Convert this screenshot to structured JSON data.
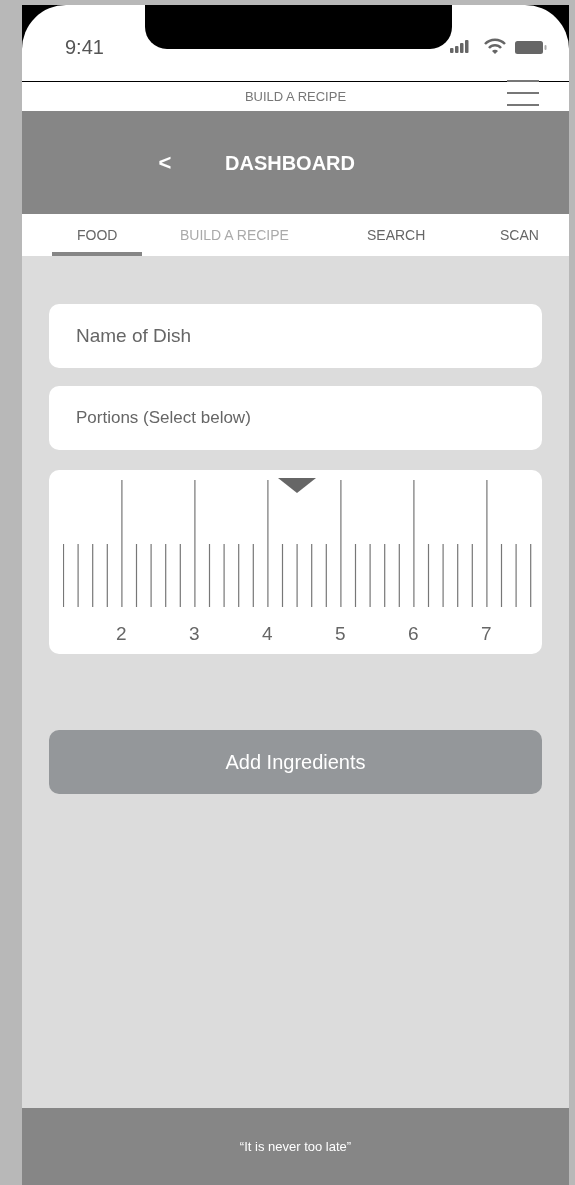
{
  "status_bar": {
    "time": "9:41"
  },
  "app_bar": {
    "title": "BUILD A RECIPE"
  },
  "header": {
    "back": "<",
    "title": "DASHBOARD"
  },
  "tabs": [
    {
      "label": "FOOD",
      "selected": true,
      "dimmed": false
    },
    {
      "label": "BUILD A RECIPE",
      "selected": false,
      "dimmed": true
    },
    {
      "label": "SEARCH",
      "selected": false,
      "dimmed": false
    },
    {
      "label": "SCAN",
      "selected": false,
      "dimmed": false
    }
  ],
  "form": {
    "dish_placeholder": "Name of Dish",
    "portions_placeholder": "Portions (Select below)"
  },
  "portion_slider": {
    "labels": [
      "2",
      "3",
      "4",
      "5",
      "6",
      "7"
    ],
    "level": 0.5
  },
  "button": "Add Ingredients",
  "footer": "“It is never too late”"
}
